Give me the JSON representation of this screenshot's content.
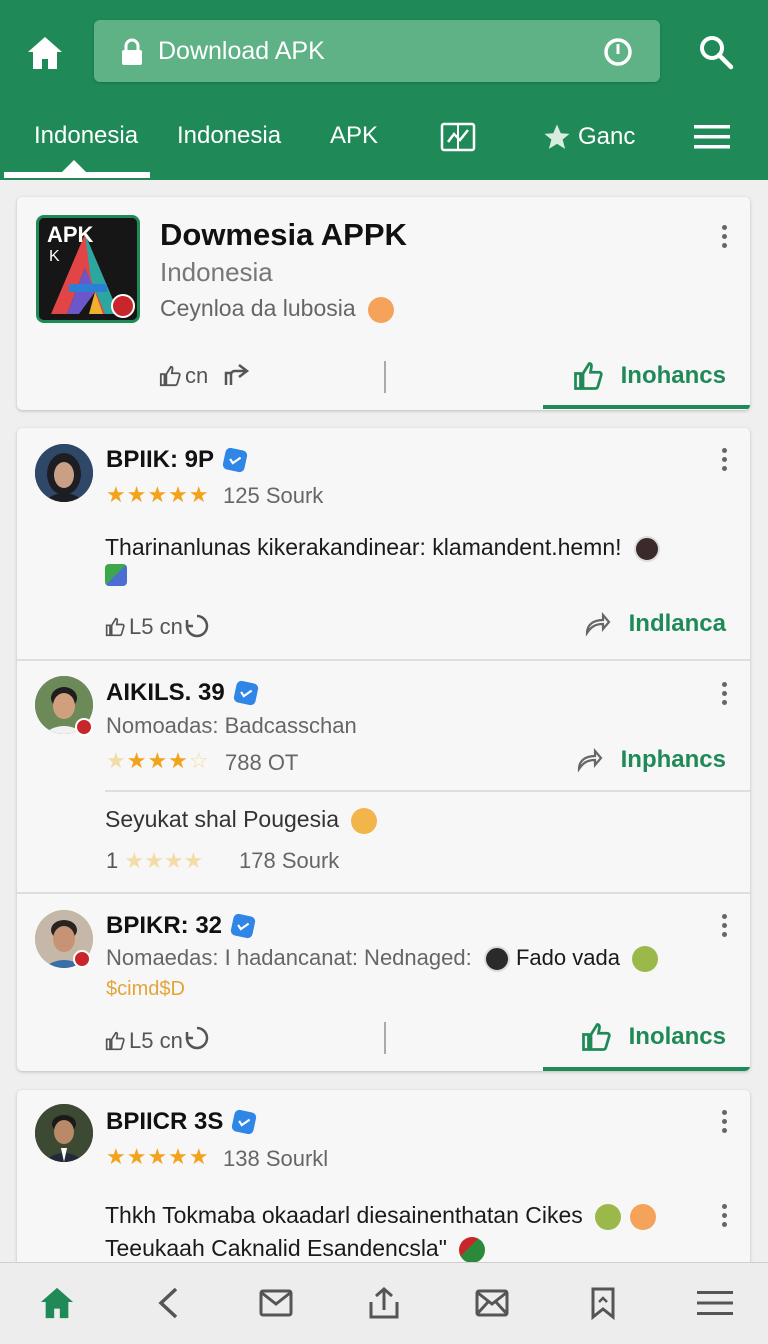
{
  "toolbar": {
    "url_text": "Download APK"
  },
  "tabs": [
    {
      "label": "Indonesia"
    },
    {
      "label": "Indonesia"
    },
    {
      "label": "APK"
    },
    {
      "label": "Ganc"
    }
  ],
  "app_card": {
    "icon_text": "APK",
    "icon_subtext": "K",
    "name": "Dowmesia APPK",
    "subtitle": "Indonesia",
    "description": "Ceynloa da lubosia",
    "like_label": "cn",
    "cta_label": "Inohancs"
  },
  "reviews": [
    {
      "name": "BPIIK: 9P",
      "rating": 5,
      "count": "125 Sourk",
      "text": "Tharinanlunas kikerakandinear: klamandent.hemn!",
      "like_label": "L5 cn",
      "cta_label": "Indlanca"
    },
    {
      "name": "AIKILS. 39",
      "meta": "Nomoadas: Badcasschan",
      "rating": 3,
      "count": "788 OT",
      "cta_label": "Inphancs",
      "sub_text": "Seyukat shal Pougesia",
      "sub_prefix": "1",
      "sub_count": "178 Sourk"
    },
    {
      "name": "BPIKR: 32",
      "meta": "Nomaedas: I hadancanat: Nednaged:",
      "meta_tail": "Fado vada",
      "tag": "$cimd$D",
      "like_label": "L5 cn",
      "cta_label": "Inolancs"
    },
    {
      "name": "BPIICR 3S",
      "rating": 5,
      "count": "138 Sourkl",
      "text_line1": "Thkh Tokmaba okaadarl diesainenthatan Cikes",
      "text_line2": "Teeukaah Caknalid Esandencsla\""
    }
  ],
  "colors": {
    "brand": "#1f8a57",
    "star": "#f3a21b",
    "verified": "#2f86e6"
  },
  "icons": [
    "home-icon",
    "lock-icon",
    "reload-icon",
    "search-icon",
    "chart-tab-icon",
    "star-icon",
    "menu-icon",
    "thumbs-up-icon",
    "share-icon",
    "back-icon",
    "mail-icon",
    "upload-icon",
    "bookmark-icon"
  ]
}
